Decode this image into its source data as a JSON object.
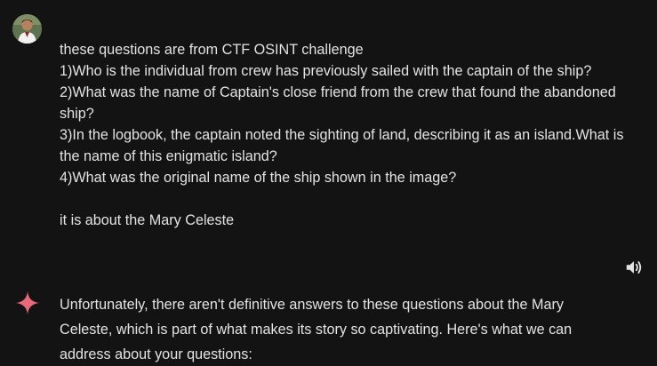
{
  "conversation": {
    "user_message": {
      "lines": [
        "these questions are from CTF OSINT challenge",
        "1)Who is the individual from crew has previously sailed with the captain of the ship?",
        "2)What was the name of Captain's close friend from the crew that found the abandoned",
        "ship?",
        "3)In the logbook, the captain noted the sighting of land, describing it as an island.What is",
        "the name of this enigmatic island?",
        "4)What was the original name of the ship shown in the image?"
      ],
      "footer": "it is about the Mary Celeste"
    },
    "model_response": {
      "lines": [
        "Unfortunately, there aren't definitive answers to these questions about the Mary",
        "Celeste, which is part of what makes its story so captivating. Here's what we can",
        "address about your questions:"
      ]
    }
  },
  "icons": {
    "avatar": "user-avatar",
    "speaker": "volume-icon",
    "sparkle": "gemini-sparkle-icon"
  },
  "colors": {
    "background": "#131314",
    "text": "#e3e3e3",
    "sparkle_pink": "#e86a7a",
    "icon": "#e3e3e3"
  }
}
